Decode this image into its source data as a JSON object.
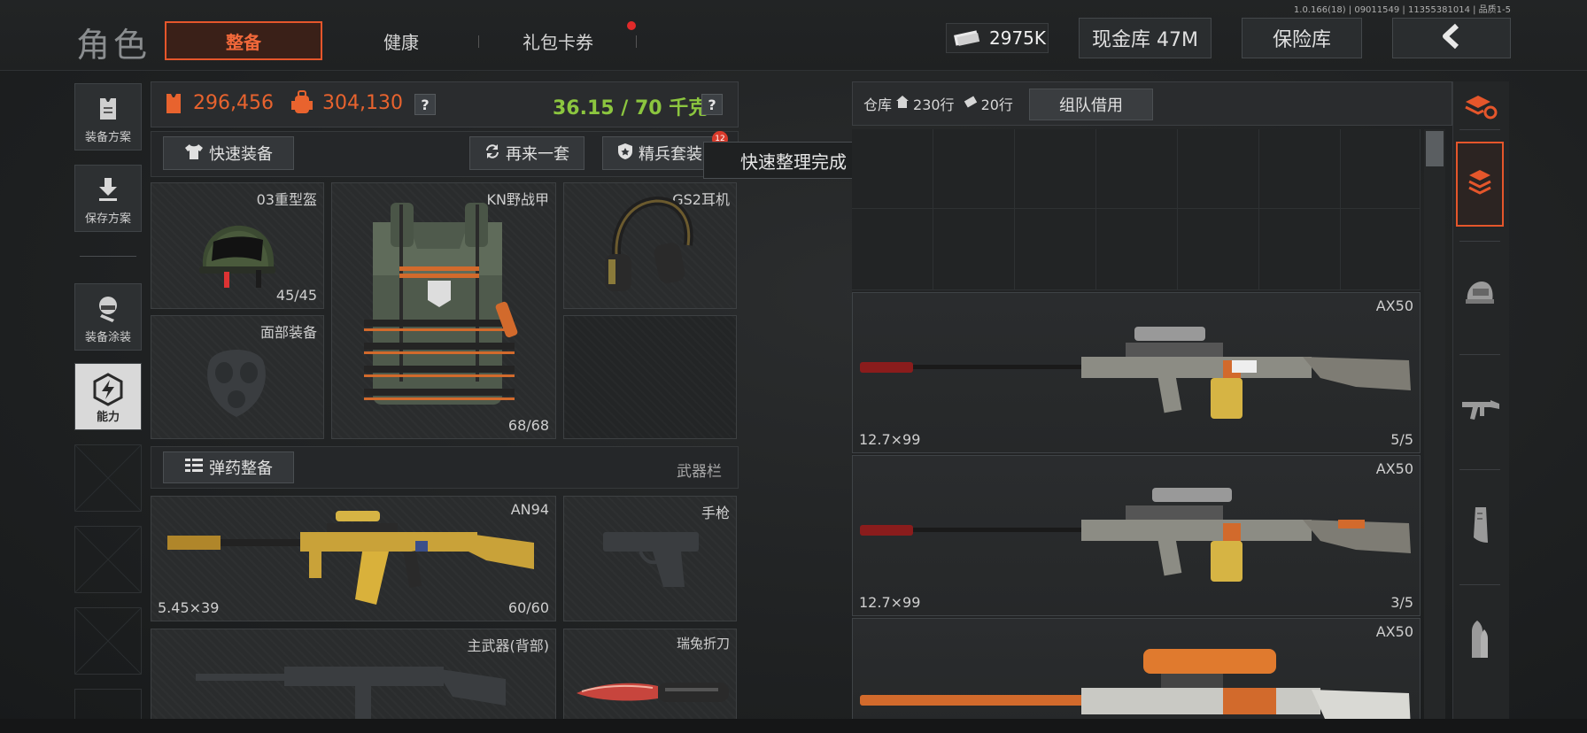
{
  "header": {
    "title": "角色",
    "tabs": [
      {
        "label": "整备",
        "active": true
      },
      {
        "label": "健康",
        "active": false
      },
      {
        "label": "礼包卡券",
        "active": false,
        "notification_dot": true
      }
    ],
    "version": "1.0.166(18) | 09011549 | 11355381014 | 品质1-5",
    "money": {
      "icon": "cash-icon",
      "value": "2975K"
    },
    "cash_vault_label": "现金库 47M",
    "safe_label": "保险库",
    "back_icon": "chevron-left-icon"
  },
  "left_nav": [
    {
      "label": "装备方案",
      "icon": "vest-icon",
      "active": false
    },
    {
      "label": "保存方案",
      "icon": "download-icon",
      "active": false
    },
    {
      "label": "装备涂装",
      "icon": "spray-icon",
      "active": false
    },
    {
      "label": "能力",
      "icon": "lightning-hex-icon",
      "active": true
    }
  ],
  "stats": {
    "armor_value": "296,456",
    "backpack_value": "304,130",
    "weight": "36.15 / 70 千克",
    "help": "?"
  },
  "actions": {
    "quick_equip": "快速装备",
    "again": "再来一套",
    "elite": "精兵套装",
    "elite_badge": "12",
    "toast": "快速整理完成"
  },
  "equipment": {
    "helmet": {
      "name": "03重型盔",
      "durability": "45/45"
    },
    "armor": {
      "name": "KN野战甲",
      "durability": "68/68"
    },
    "headset": {
      "name": "GS2耳机"
    },
    "face": {
      "name": "面部装备"
    }
  },
  "weapons_section": {
    "ammo_button": "弹药整备",
    "label": "武器栏"
  },
  "weapons": {
    "primary": {
      "name": "AN94",
      "ammo": "5.45×39",
      "durability": "60/60"
    },
    "pistol": {
      "name": "手枪"
    },
    "back": {
      "name": "主武器(背部)"
    },
    "melee": {
      "name": "瑞兔折刀"
    }
  },
  "storage": {
    "label": "仓库",
    "rows": "230行",
    "rows2": "20行",
    "team_borrow": "组队借用",
    "items": [
      {
        "name": "AX50",
        "ammo": "12.7×99",
        "count": "5/5"
      },
      {
        "name": "AX50",
        "ammo": "12.7×99",
        "count": "3/5"
      },
      {
        "name": "AX50",
        "ammo": "",
        "count": ""
      }
    ]
  },
  "right_nav": [
    {
      "icon": "stack-refresh-icon",
      "active": false
    },
    {
      "icon": "layers-icon",
      "active": true
    },
    {
      "icon": "helmet-icon",
      "active": false
    },
    {
      "icon": "rifle-icon",
      "active": false
    },
    {
      "icon": "magazine-icon",
      "active": false
    },
    {
      "icon": "bullet-icon",
      "active": false
    }
  ],
  "colors": {
    "accent_orange": "#e5562b",
    "weight_green": "#8cc63f",
    "value_orange": "#e8632e"
  }
}
